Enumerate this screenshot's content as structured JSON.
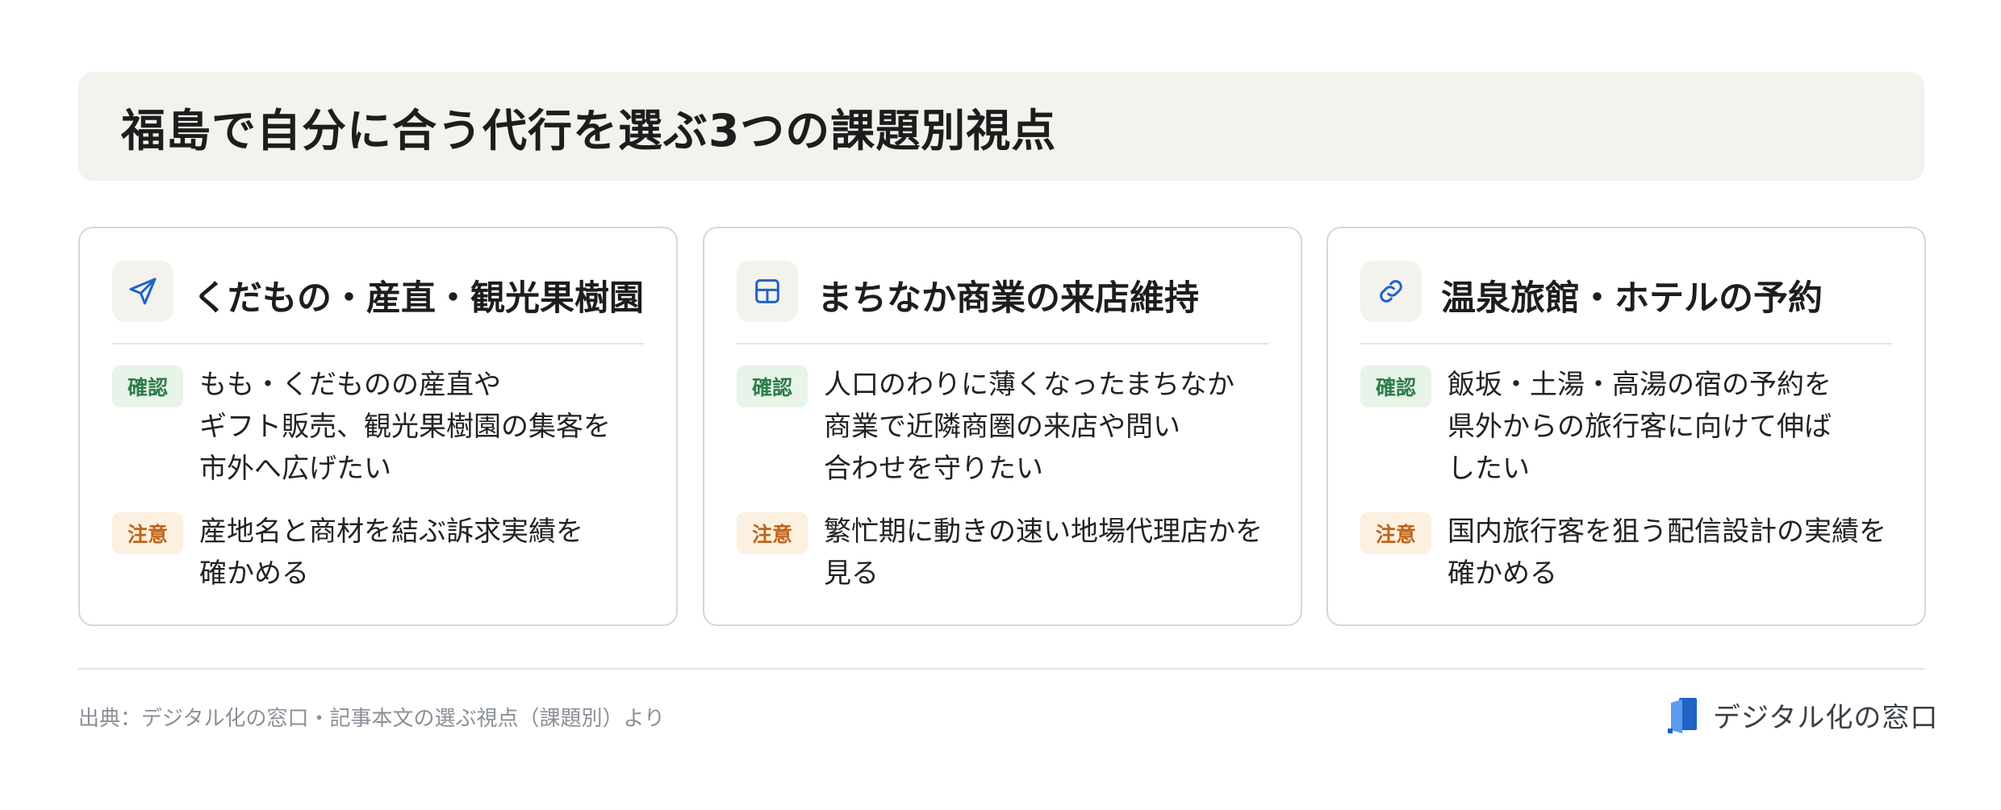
{
  "header": {
    "title": "福島で自分に合う代行を選ぶ3つの課題別視点"
  },
  "cards": [
    {
      "icon": "send-icon",
      "title": "くだもの・産直・観光果樹園",
      "confirm_label": "確認",
      "confirm_text": "もも・くだものの産直や\nギフト販売、観光果樹園の集客を\n市外へ広げたい",
      "caution_label": "注意",
      "caution_text": "産地名と商材を結ぶ訴求実績を\n確かめる"
    },
    {
      "icon": "grid-icon",
      "title": "まちなか商業の来店維持",
      "confirm_label": "確認",
      "confirm_text": "人口のわりに薄くなったまちなか\n商業で近隣商圏の来店や問い\n合わせを守りたい",
      "caution_label": "注意",
      "caution_text": "繁忙期に動きの速い地場代理店かを\n見る"
    },
    {
      "icon": "link-icon",
      "title": "温泉旅館・ホテルの予約",
      "confirm_label": "確認",
      "confirm_text": "飯坂・土湯・高湯の宿の予約を\n県外からの旅行客に向けて伸ば\nしたい",
      "caution_label": "注意",
      "caution_text": "国内旅行客を狙う配信設計の実績を\n確かめる"
    }
  ],
  "footer": {
    "source": "出典：デジタル化の窓口・記事本文の選ぶ視点（課題別）より",
    "logo_text": "デジタル化の窓口"
  },
  "colors": {
    "accent_blue": "#1f63c6",
    "confirm_green": "#2e7d4a",
    "caution_orange": "#c0651a",
    "title_bg": "#f4f2ec"
  }
}
